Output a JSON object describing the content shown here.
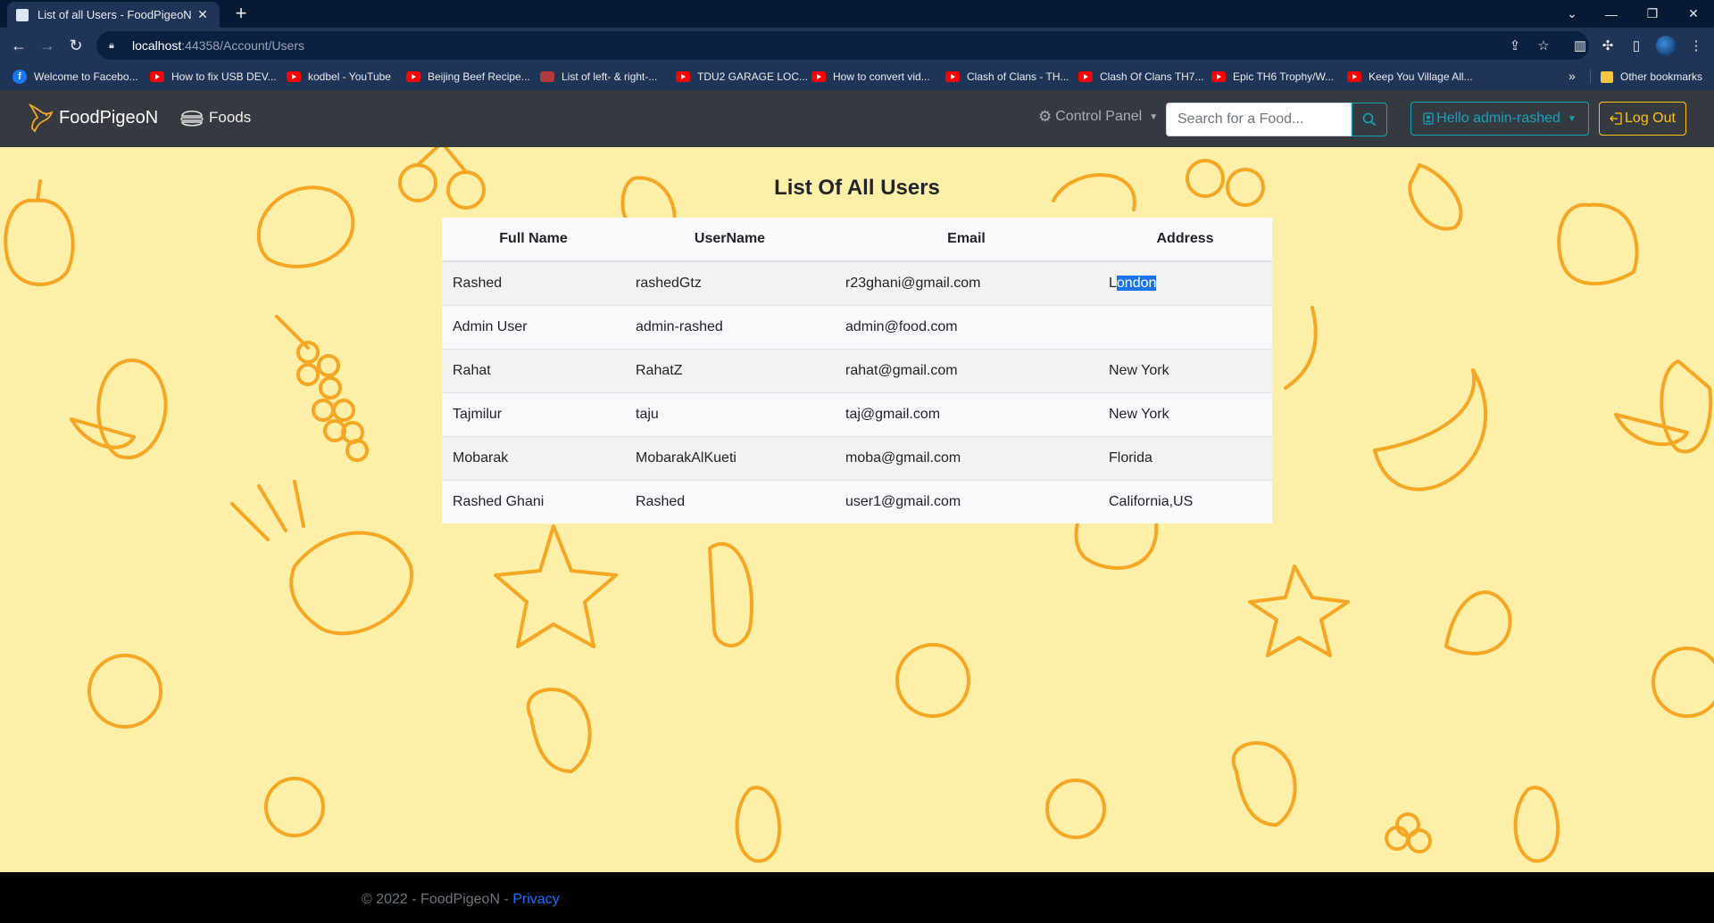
{
  "browser": {
    "tab_title": "List of all Users - FoodPigeoN",
    "url_host": "localhost",
    "url_path": ":44358/Account/Users",
    "bookmarks": [
      {
        "label": "Welcome to Facebo...",
        "icon": "facebook-icon"
      },
      {
        "label": "How to fix USB DEV...",
        "icon": "youtube-icon"
      },
      {
        "label": "kodbel - YouTube",
        "icon": "youtube-icon"
      },
      {
        "label": "Beijing Beef Recipe...",
        "icon": "youtube-icon"
      },
      {
        "label": "List of left- & right-...",
        "icon": "site-icon"
      },
      {
        "label": "TDU2 GARAGE LOC...",
        "icon": "youtube-icon"
      },
      {
        "label": "How to convert vid...",
        "icon": "youtube-icon"
      },
      {
        "label": "Clash of Clans - TH...",
        "icon": "youtube-icon"
      },
      {
        "label": "Clash Of Clans TH7...",
        "icon": "youtube-icon"
      },
      {
        "label": "Epic TH6 Trophy/W...",
        "icon": "youtube-icon"
      },
      {
        "label": "Keep You Village All...",
        "icon": "youtube-icon"
      }
    ],
    "more_bookmarks": "»",
    "other_bookmarks": "Other bookmarks"
  },
  "navbar": {
    "brand": "FoodPigeoN",
    "foods_label": "Foods",
    "control_panel_label": "Control Panel",
    "search_placeholder": "Search for a Food...",
    "hello_label": "Hello admin-rashed",
    "logout_label": "Log Out"
  },
  "page": {
    "title": "List Of All Users",
    "columns": [
      "Full Name",
      "UserName",
      "Email",
      "Address"
    ],
    "rows": [
      {
        "full_name": "Rashed",
        "username": "rashedGtz",
        "email": "r23ghani@gmail.com",
        "address_prefix": "L",
        "address_selected": "ondon"
      },
      {
        "full_name": "Admin User",
        "username": "admin-rashed",
        "email": "admin@food.com",
        "address": ""
      },
      {
        "full_name": "Rahat",
        "username": "RahatZ",
        "email": "rahat@gmail.com",
        "address": "New York"
      },
      {
        "full_name": "Tajmilur",
        "username": "taju",
        "email": "taj@gmail.com",
        "address": "New York"
      },
      {
        "full_name": "Mobarak",
        "username": "MobarakAlKueti",
        "email": "moba@gmail.com",
        "address": "Florida"
      },
      {
        "full_name": "Rashed Ghani",
        "username": "Rashed",
        "email": "user1@gmail.com",
        "address": "California,US"
      }
    ]
  },
  "footer": {
    "text": "© 2022 - FoodPigeoN - ",
    "privacy_label": "Privacy"
  },
  "colors": {
    "background_yellow": "#fdeea8",
    "fruit_orange": "#f5a623",
    "navbar": "#343a40",
    "info": "#17a2b8",
    "warning": "#ffc107"
  }
}
